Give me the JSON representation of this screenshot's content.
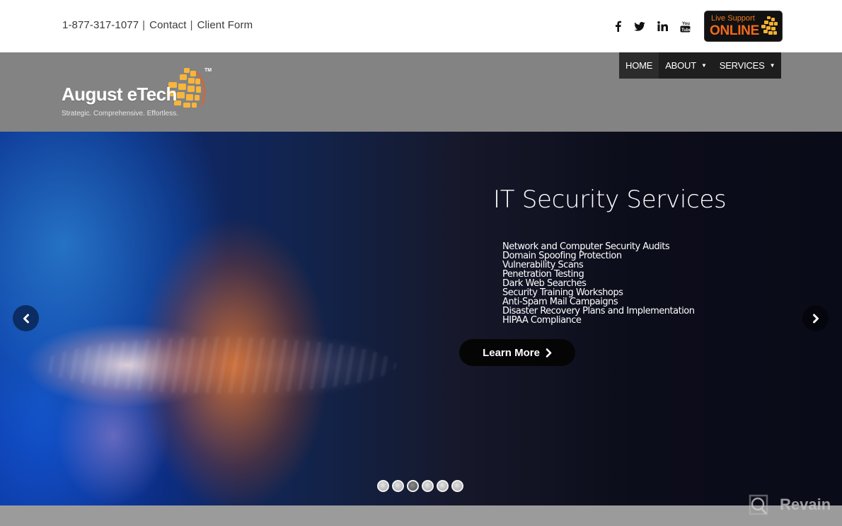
{
  "topbar": {
    "phone": "1-877-317-1077",
    "separator": "|",
    "contact_label": "Contact",
    "client_form_label": "Client Form",
    "social": [
      "facebook-icon",
      "twitter-icon",
      "linkedin-icon",
      "youtube-icon"
    ],
    "live_support": {
      "top_text": "Live Support",
      "main_text": "ONLINE"
    }
  },
  "header": {
    "logo_text": "August eTech",
    "logo_tm": "TM",
    "tagline": "Strategic. Comprehensive. Effortless.",
    "nav": [
      {
        "label": "HOME",
        "active": true,
        "has_dropdown": false
      },
      {
        "label": "ABOUT",
        "active": false,
        "has_dropdown": true
      },
      {
        "label": "SERVICES",
        "active": false,
        "has_dropdown": true
      }
    ],
    "caret_glyph": "▼"
  },
  "slider": {
    "title": "IT Security Services",
    "items": [
      "Network and Computer Security Audits",
      "Domain Spoofing Protection",
      "Vulnerability Scans",
      "Penetration Testing",
      "Dark Web Searches",
      "Security Training Workshops",
      "Anti-Spam Mail Campaigns",
      "Disaster Recovery Plans and Implementation",
      "HIPAA Compliance"
    ],
    "cta_label": "Learn More",
    "slide_count": 6,
    "active_slide": 3
  },
  "watermark": {
    "text": "Revain"
  },
  "colors": {
    "brand_orange": "#f26a1b",
    "nav_bg": "#1e1e1e",
    "header_bg": "#838383"
  }
}
